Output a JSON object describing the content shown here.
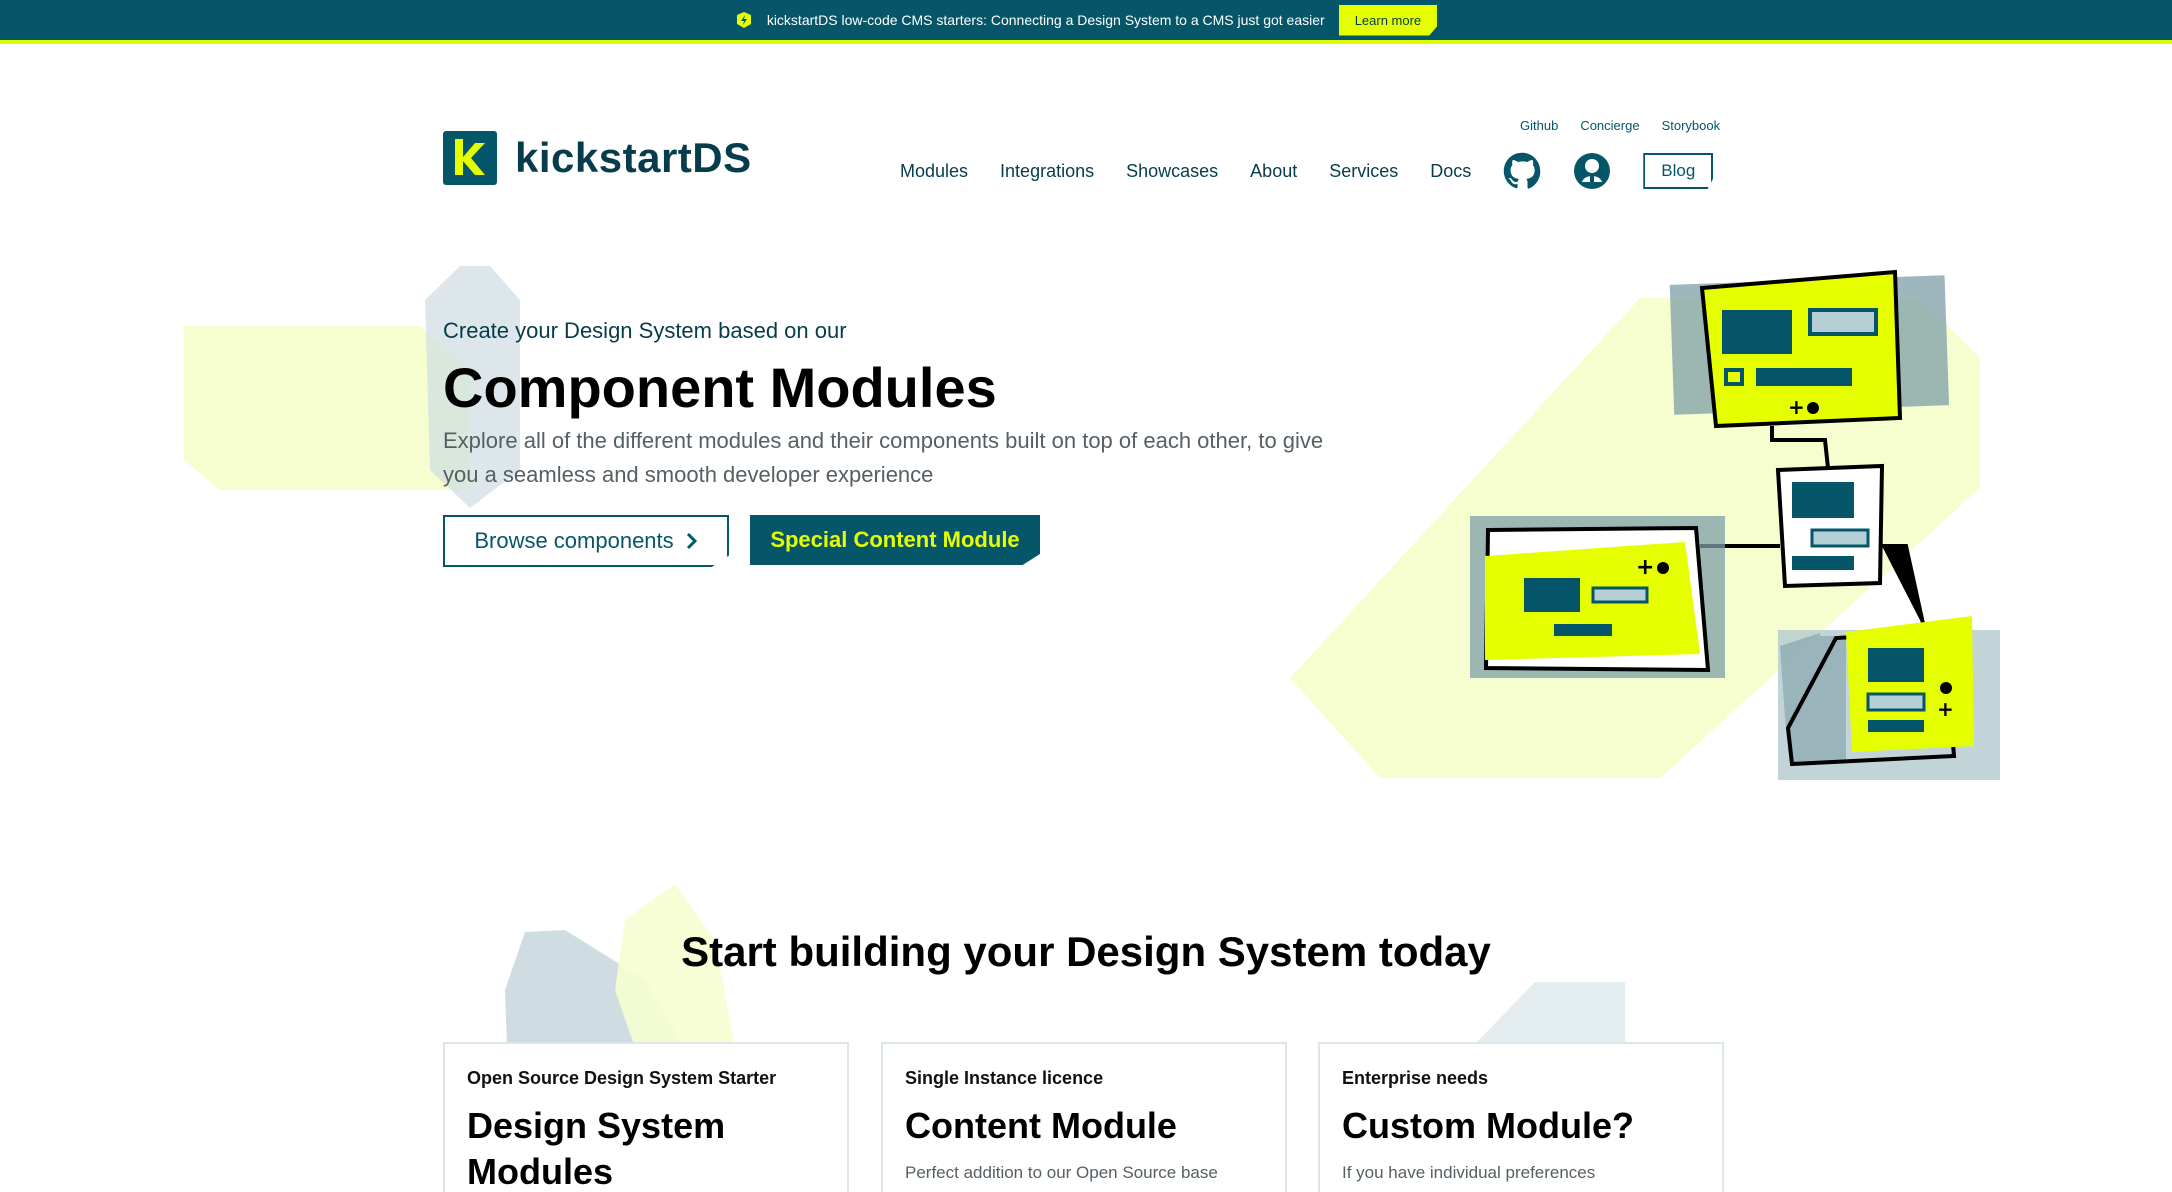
{
  "banner": {
    "message": "kickstartDS low-code CMS starters: Connecting a Design System to a CMS just got easier",
    "cta": "Learn more"
  },
  "header": {
    "logo_text": "kickstartDS",
    "meta_links": [
      "Github",
      "Concierge",
      "Storybook"
    ],
    "nav": [
      "Modules",
      "Integrations",
      "Showcases",
      "About",
      "Services",
      "Docs"
    ],
    "blog": "Blog"
  },
  "hero": {
    "subtitle": "Create your Design System based on our",
    "title": "Component Modules",
    "description": "Explore all of the different modules and their components built on top of each other, to give you a seamless and smooth developer experience",
    "browse_label": "Browse components",
    "special_label": "Special Content Module"
  },
  "section": {
    "title": "Start building your Design System today",
    "cards": [
      {
        "kicker": "Open Source Design System Starter",
        "title": "Design System Modules",
        "desc": ""
      },
      {
        "kicker": "Single Instance licence",
        "title": "Content Module",
        "desc": "Perfect addition to our Open Source base"
      },
      {
        "kicker": "Enterprise needs",
        "title": "Custom Module?",
        "desc": "If you have individual preferences"
      }
    ]
  },
  "colors": {
    "brand": "#06566a",
    "accent": "#e6ff00",
    "text": "#063c4b"
  },
  "icons": [
    "bolt-icon",
    "logo-k-icon",
    "github-icon",
    "concierge-icon",
    "chevron-right-icon"
  ]
}
